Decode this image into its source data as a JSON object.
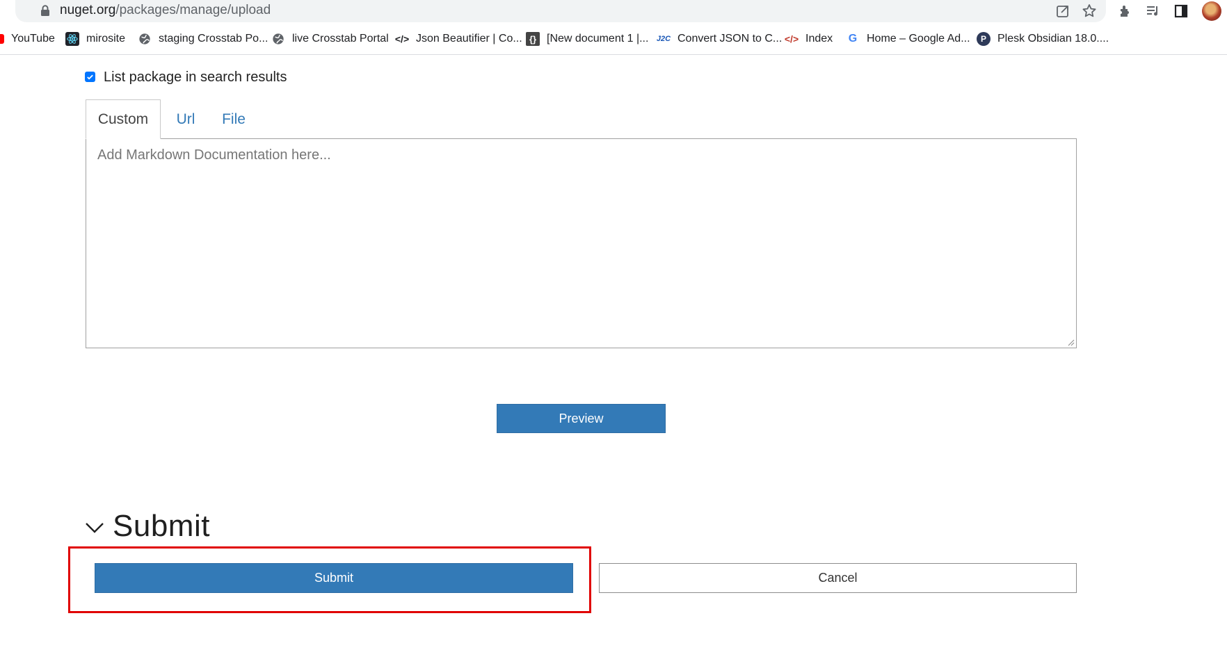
{
  "browser": {
    "url_host": "nuget.org",
    "url_path": "/packages/manage/upload",
    "toolbar_icons": [
      "share-icon",
      "star-icon",
      "extensions-icon",
      "media-control-icon",
      "side-panel-icon",
      "profile-avatar"
    ]
  },
  "bookmarks": [
    {
      "label": "YouTube",
      "icon": "youtube-icon"
    },
    {
      "label": "mirosite",
      "icon": "react-icon"
    },
    {
      "label": "staging Crosstab Po...",
      "icon": "globe-icon"
    },
    {
      "label": "live Crosstab Portal",
      "icon": "globe-icon"
    },
    {
      "label": "Json Beautifier | Co...",
      "icon": "code-icon"
    },
    {
      "label": "[New document 1 |...",
      "icon": "braces-icon"
    },
    {
      "label": "Convert JSON to C...",
      "icon": "j2c-icon"
    },
    {
      "label": "Index",
      "icon": "code-icon"
    },
    {
      "label": "Home – Google Ad...",
      "icon": "google-icon"
    },
    {
      "label": "Plesk Obsidian 18.0....",
      "icon": "plesk-icon"
    }
  ],
  "form": {
    "list_in_search": {
      "label": "List package in search results",
      "checked": true
    },
    "doc_tabs": [
      "Custom",
      "Url",
      "File"
    ],
    "active_tab": "Custom",
    "markdown_placeholder": "Add Markdown Documentation here...",
    "preview_button": "Preview"
  },
  "submit_section": {
    "title": "Submit",
    "submit_button": "Submit",
    "cancel_button": "Cancel"
  },
  "colors": {
    "primary": "#337ab7",
    "highlight": "#e00000",
    "checkbox": "#0075ff"
  }
}
